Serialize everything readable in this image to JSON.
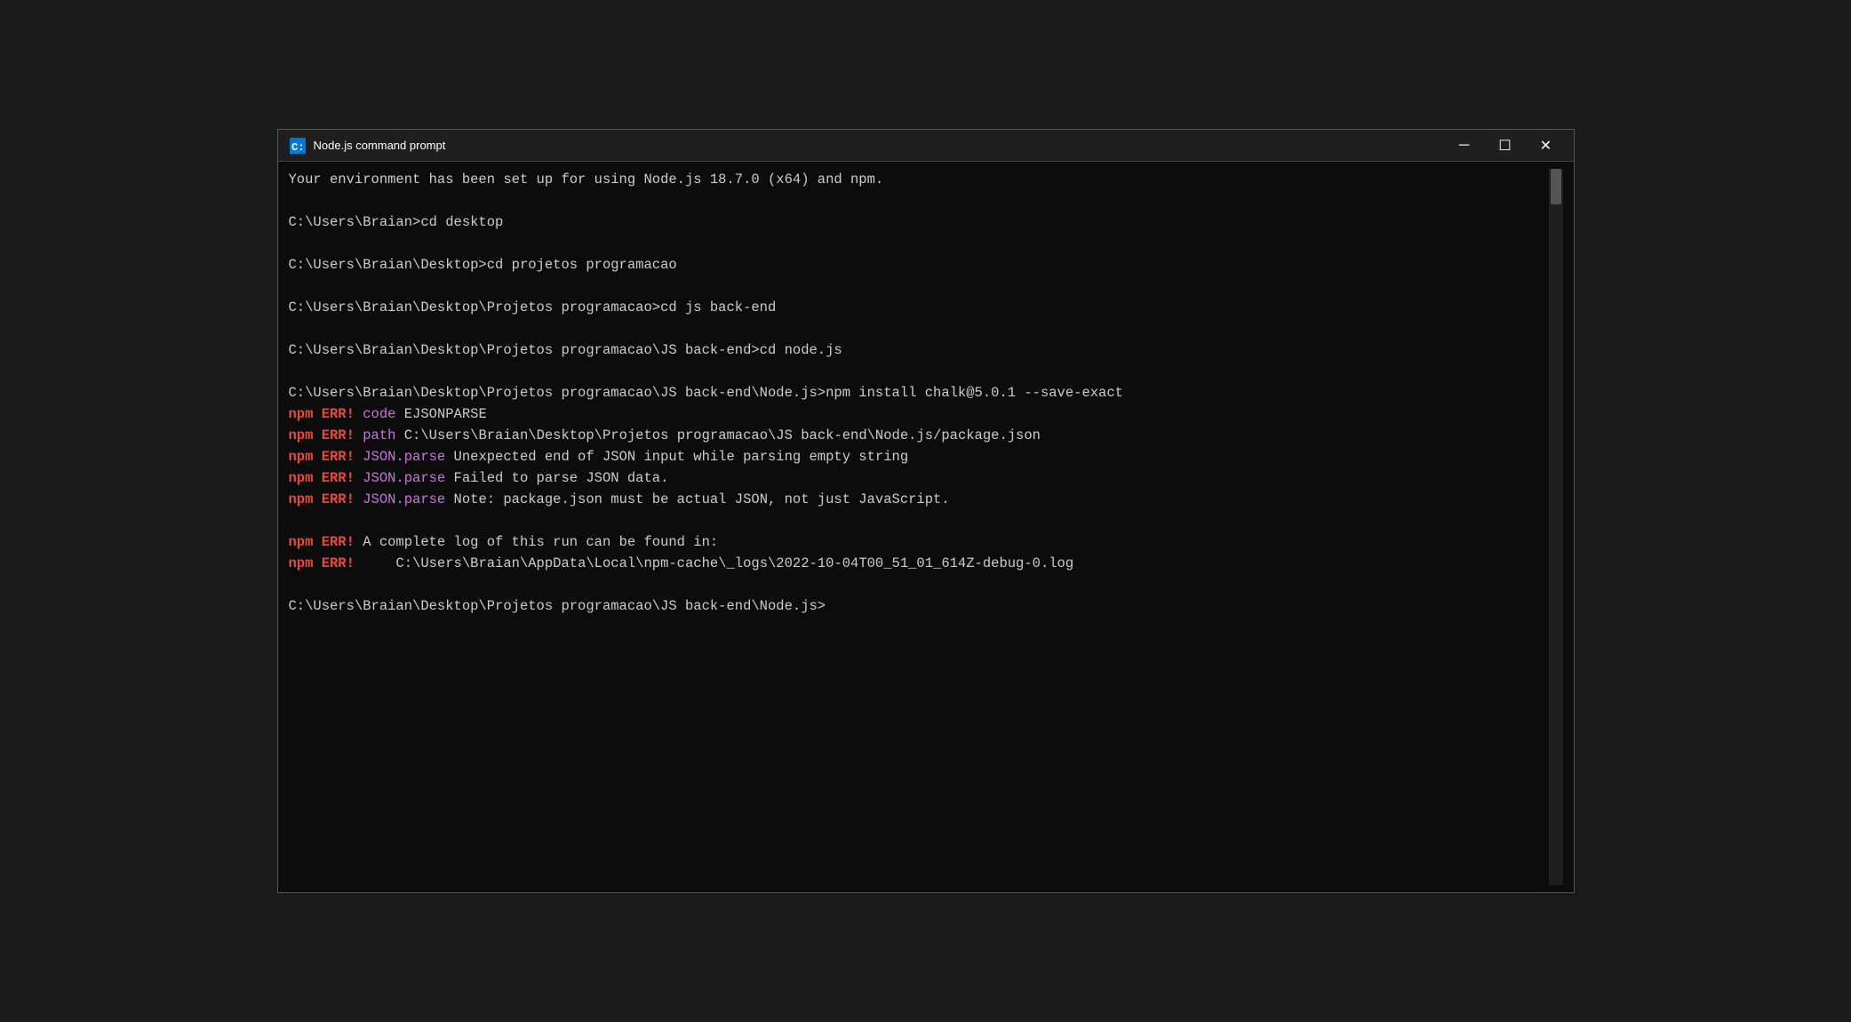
{
  "window": {
    "title": "Node.js command prompt",
    "icon": "cmd-icon"
  },
  "titlebar": {
    "minimize_label": "─",
    "maximize_label": "☐",
    "close_label": "✕"
  },
  "terminal": {
    "lines": [
      {
        "id": "line-env",
        "type": "normal",
        "text": "Your environment has been set up for using Node.js 18.7.0 (x64) and npm."
      },
      {
        "id": "line-blank1",
        "type": "blank"
      },
      {
        "id": "line-cd1",
        "type": "normal",
        "text": "C:\\Users\\Braian>cd desktop"
      },
      {
        "id": "line-blank2",
        "type": "blank"
      },
      {
        "id": "line-cd2",
        "type": "normal",
        "text": "C:\\Users\\Braian\\Desktop>cd projetos programacao"
      },
      {
        "id": "line-blank3",
        "type": "blank"
      },
      {
        "id": "line-cd3",
        "type": "normal",
        "text": "C:\\Users\\Braian\\Desktop\\Projetos programacao>cd js back-end"
      },
      {
        "id": "line-blank4",
        "type": "blank"
      },
      {
        "id": "line-cd4",
        "type": "normal",
        "text": "C:\\Users\\Braian\\Desktop\\Projetos programacao\\JS back-end>cd node.js"
      },
      {
        "id": "line-blank5",
        "type": "blank"
      },
      {
        "id": "line-npm-install",
        "type": "normal",
        "text": "C:\\Users\\Braian\\Desktop\\Projetos programacao\\JS back-end\\Node.js>npm install chalk@5.0.1 --save-exact"
      },
      {
        "id": "line-err1",
        "type": "npm-err",
        "prefix": "npm ERR!",
        "label": "code",
        "rest": " EJSONPARSE"
      },
      {
        "id": "line-err2",
        "type": "npm-err",
        "prefix": "npm ERR!",
        "label": "path",
        "rest": " C:\\Users\\Braian\\Desktop\\Projetos programacao\\JS back-end\\Node.js/package.json"
      },
      {
        "id": "line-err3",
        "type": "npm-err",
        "prefix": "npm ERR!",
        "label": "JSON.parse",
        "rest": " Unexpected end of JSON input while parsing empty string"
      },
      {
        "id": "line-err4",
        "type": "npm-err",
        "prefix": "npm ERR!",
        "label": "JSON.parse",
        "rest": " Failed to parse JSON data."
      },
      {
        "id": "line-err5",
        "type": "npm-err",
        "prefix": "npm ERR!",
        "label": "JSON.parse",
        "rest": " Note: package.json must be actual JSON, not just JavaScript."
      },
      {
        "id": "line-blank6",
        "type": "blank"
      },
      {
        "id": "line-err6",
        "type": "npm-err-plain",
        "text": "npm ERR! A complete log of this run can be found in:"
      },
      {
        "id": "line-err7",
        "type": "npm-err-plain",
        "text": "npm ERR!     C:\\Users\\Braian\\AppData\\Local\\npm-cache\\_logs\\2022-10-04T00_51_01_614Z-debug-0.log"
      },
      {
        "id": "line-blank7",
        "type": "blank"
      },
      {
        "id": "line-prompt",
        "type": "normal",
        "text": "C:\\Users\\Braian\\Desktop\\Projetos programacao\\JS back-end\\Node.js>"
      }
    ]
  }
}
